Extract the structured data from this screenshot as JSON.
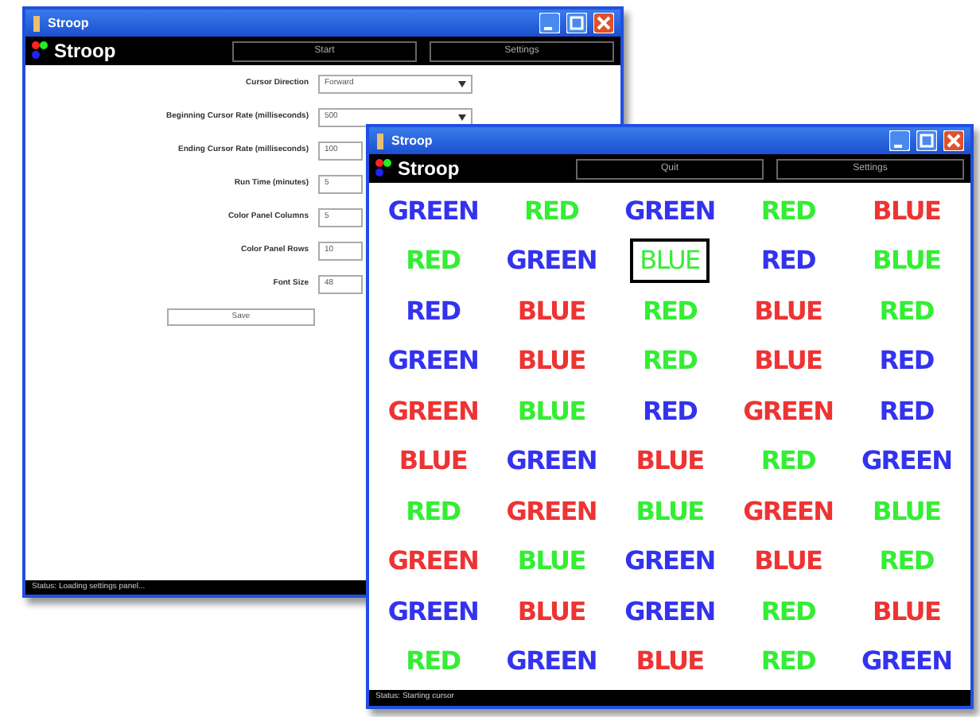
{
  "settings_window": {
    "title": "Stroop",
    "logo": "Stroop",
    "toolbar_buttons": [
      "Start",
      "Settings"
    ],
    "fields": [
      {
        "label": "Cursor Direction",
        "value": "Forward",
        "kind": "dropdown"
      },
      {
        "label": "Beginning Cursor Rate (milliseconds)",
        "value": "500",
        "kind": "dropdown"
      },
      {
        "label": "Ending Cursor Rate (milliseconds)",
        "value": "100",
        "kind": "text"
      },
      {
        "label": "Run Time (minutes)",
        "value": "5",
        "kind": "text"
      },
      {
        "label": "Color Panel Columns",
        "value": "5",
        "kind": "text"
      },
      {
        "label": "Color Panel Rows",
        "value": "10",
        "kind": "text"
      },
      {
        "label": "Font Size",
        "value": "48",
        "kind": "text"
      }
    ],
    "save_button": "Save",
    "status_bar": "Status: Loading settings panel..."
  },
  "test_window": {
    "title": "Stroop",
    "logo": "Stroop",
    "toolbar_buttons": [
      "Quit",
      "Settings"
    ],
    "rows": [
      [
        {
          "word": "GREEN",
          "color": "#3333ee",
          "selected": false
        },
        {
          "word": "RED",
          "color": "#33ee33",
          "selected": false
        },
        {
          "word": "GREEN",
          "color": "#3333ee",
          "selected": false
        },
        {
          "word": "RED",
          "color": "#33ee33",
          "selected": false
        },
        {
          "word": "BLUE",
          "color": "#ee3333",
          "selected": false
        }
      ],
      [
        {
          "word": "RED",
          "color": "#33ee33",
          "selected": false
        },
        {
          "word": "GREEN",
          "color": "#3333ee",
          "selected": false
        },
        {
          "word": "BLUE",
          "color": "#33ee33",
          "selected": true
        },
        {
          "word": "RED",
          "color": "#3333ee",
          "selected": false
        },
        {
          "word": "BLUE",
          "color": "#33ee33",
          "selected": false
        }
      ],
      [
        {
          "word": "RED",
          "color": "#3333ee",
          "selected": false
        },
        {
          "word": "BLUE",
          "color": "#ee3333",
          "selected": false
        },
        {
          "word": "RED",
          "color": "#33ee33",
          "selected": false
        },
        {
          "word": "BLUE",
          "color": "#ee3333",
          "selected": false
        },
        {
          "word": "RED",
          "color": "#33ee33",
          "selected": false
        }
      ],
      [
        {
          "word": "GREEN",
          "color": "#3333ee",
          "selected": false
        },
        {
          "word": "BLUE",
          "color": "#ee3333",
          "selected": false
        },
        {
          "word": "RED",
          "color": "#33ee33",
          "selected": false
        },
        {
          "word": "BLUE",
          "color": "#ee3333",
          "selected": false
        },
        {
          "word": "RED",
          "color": "#3333ee",
          "selected": false
        }
      ],
      [
        {
          "word": "GREEN",
          "color": "#ee3333",
          "selected": false
        },
        {
          "word": "BLUE",
          "color": "#33ee33",
          "selected": false
        },
        {
          "word": "RED",
          "color": "#3333ee",
          "selected": false
        },
        {
          "word": "GREEN",
          "color": "#ee3333",
          "selected": false
        },
        {
          "word": "RED",
          "color": "#3333ee",
          "selected": false
        }
      ],
      [
        {
          "word": "BLUE",
          "color": "#ee3333",
          "selected": false
        },
        {
          "word": "GREEN",
          "color": "#3333ee",
          "selected": false
        },
        {
          "word": "BLUE",
          "color": "#ee3333",
          "selected": false
        },
        {
          "word": "RED",
          "color": "#33ee33",
          "selected": false
        },
        {
          "word": "GREEN",
          "color": "#3333ee",
          "selected": false
        }
      ],
      [
        {
          "word": "RED",
          "color": "#33ee33",
          "selected": false
        },
        {
          "word": "GREEN",
          "color": "#ee3333",
          "selected": false
        },
        {
          "word": "BLUE",
          "color": "#33ee33",
          "selected": false
        },
        {
          "word": "GREEN",
          "color": "#ee3333",
          "selected": false
        },
        {
          "word": "BLUE",
          "color": "#33ee33",
          "selected": false
        }
      ],
      [
        {
          "word": "GREEN",
          "color": "#ee3333",
          "selected": false
        },
        {
          "word": "BLUE",
          "color": "#33ee33",
          "selected": false
        },
        {
          "word": "GREEN",
          "color": "#3333ee",
          "selected": false
        },
        {
          "word": "BLUE",
          "color": "#ee3333",
          "selected": false
        },
        {
          "word": "RED",
          "color": "#33ee33",
          "selected": false
        }
      ],
      [
        {
          "word": "GREEN",
          "color": "#3333ee",
          "selected": false
        },
        {
          "word": "BLUE",
          "color": "#ee3333",
          "selected": false
        },
        {
          "word": "GREEN",
          "color": "#3333ee",
          "selected": false
        },
        {
          "word": "RED",
          "color": "#33ee33",
          "selected": false
        },
        {
          "word": "BLUE",
          "color": "#ee3333",
          "selected": false
        }
      ],
      [
        {
          "word": "RED",
          "color": "#33ee33",
          "selected": false
        },
        {
          "word": "GREEN",
          "color": "#3333ee",
          "selected": false
        },
        {
          "word": "BLUE",
          "color": "#ee3333",
          "selected": false
        },
        {
          "word": "RED",
          "color": "#33ee33",
          "selected": false
        },
        {
          "word": "GREEN",
          "color": "#3333ee",
          "selected": false
        }
      ]
    ],
    "status_bar": "Status: Starting cursor"
  }
}
